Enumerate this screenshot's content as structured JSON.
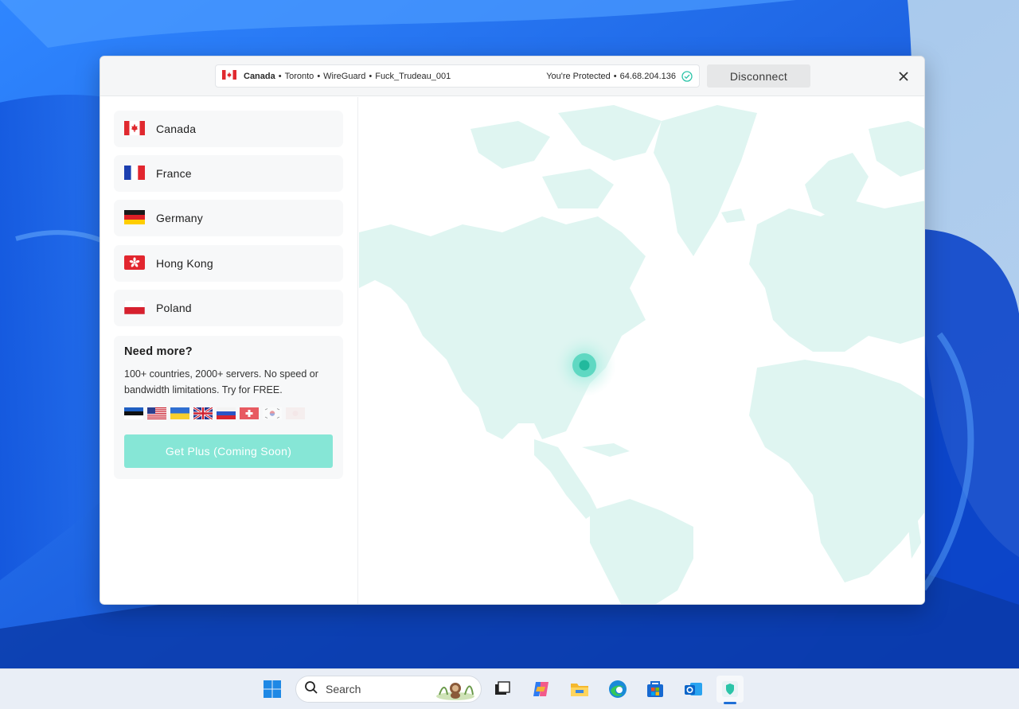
{
  "status_bar": {
    "country": "Canada",
    "city": "Toronto",
    "protocol": "WireGuard",
    "server": "Fuck_Trudeau_001",
    "separator": "•",
    "protected_text": "You're Protected",
    "ip": "64.68.204.136",
    "flag_icon": "canada-flag-icon",
    "check_icon": "check-circle-icon"
  },
  "toolbar": {
    "disconnect_label": "Disconnect",
    "close_icon": "close-icon"
  },
  "countries": [
    {
      "name": "Canada",
      "flag": "canada-flag-icon"
    },
    {
      "name": "France",
      "flag": "france-flag-icon"
    },
    {
      "name": "Germany",
      "flag": "germany-flag-icon"
    },
    {
      "name": "Hong Kong",
      "flag": "hong-kong-flag-icon"
    },
    {
      "name": "Poland",
      "flag": "poland-flag-icon"
    }
  ],
  "promo": {
    "title": "Need more?",
    "description": "100+ countries, 2000+ servers. No speed or bandwidth limitations. Try for FREE.",
    "button_label": "Get Plus (Coming Soon)",
    "flags": [
      "estonia-flag-icon",
      "usa-flag-icon",
      "ukraine-flag-icon",
      "uk-flag-icon",
      "russia-flag-icon",
      "switzerland-flag-icon",
      "south-korea-flag-icon",
      "japan-flag-icon"
    ]
  },
  "map": {
    "marker": "connection-location-marker",
    "land_color": "#dff5f1",
    "marker_color": "#2bc4a8"
  },
  "colors": {
    "accent": "#86e6d6",
    "wallpaper": "#1a5fe0"
  },
  "taskbar": {
    "search_placeholder": "Search",
    "icons": [
      "windows-start-icon",
      "search-icon",
      "task-view-icon",
      "copilot-icon",
      "file-explorer-icon",
      "edge-browser-icon",
      "microsoft-store-icon",
      "outlook-icon",
      "vpn-app-icon"
    ]
  }
}
